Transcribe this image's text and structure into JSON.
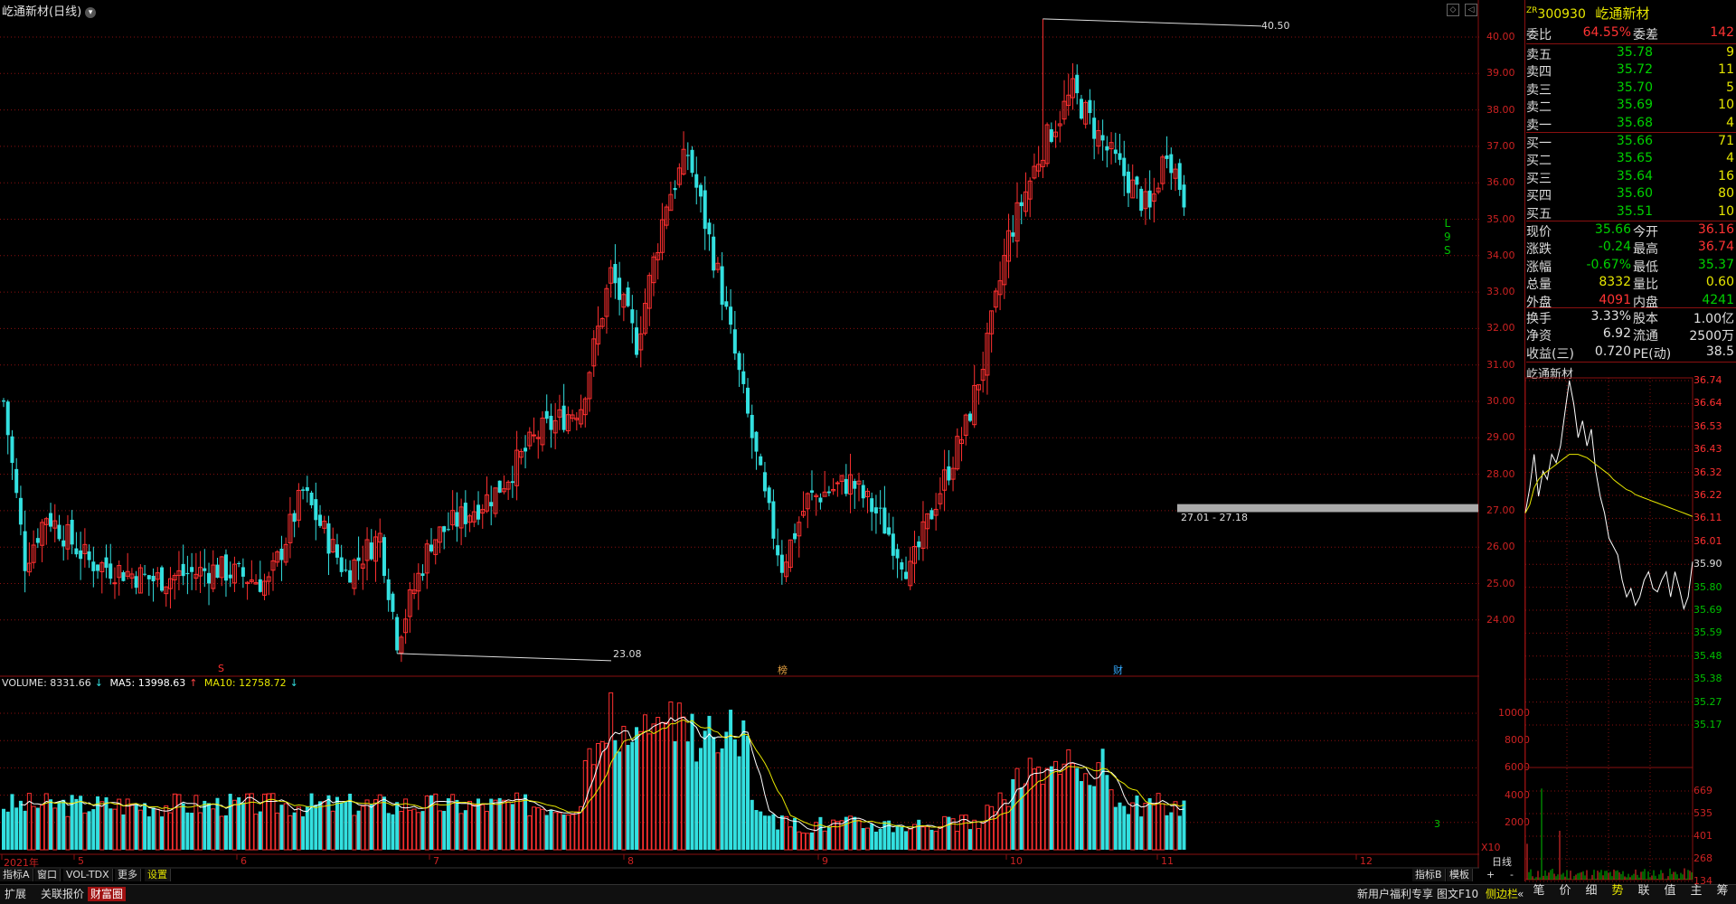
{
  "window": {
    "title": "屹通新材(日线)",
    "title_icon": "chevron-down-icon"
  },
  "price_axis": [
    {
      "label": "40.00",
      "v": 40
    },
    {
      "label": "39.00",
      "v": 39
    },
    {
      "label": "38.00",
      "v": 38
    },
    {
      "label": "37.00",
      "v": 37
    },
    {
      "label": "36.00",
      "v": 36
    },
    {
      "label": "35.00",
      "v": 35
    },
    {
      "label": "34.00",
      "v": 34
    },
    {
      "label": "33.00",
      "v": 33
    },
    {
      "label": "32.00",
      "v": 32
    },
    {
      "label": "31.00",
      "v": 31
    },
    {
      "label": "30.00",
      "v": 30
    },
    {
      "label": "29.00",
      "v": 29
    },
    {
      "label": "28.00",
      "v": 28
    },
    {
      "label": "27.00",
      "v": 27
    },
    {
      "label": "26.00",
      "v": 26
    },
    {
      "label": "25.00",
      "v": 25
    },
    {
      "label": "24.00",
      "v": 24
    }
  ],
  "annotations": {
    "high_label": "40.50",
    "low_label": "23.08",
    "range_label": "27.01 - 27.18",
    "markers": [
      "S",
      "榜",
      "财"
    ],
    "side_letters": [
      "L",
      "9",
      "S"
    ]
  },
  "volume_indicator": {
    "name": "VOLUME: 8331.66",
    "ma5": "MA5: 13998.63",
    "ma10": "MA10: 12758.72",
    "ticks": [
      "10000",
      "8000",
      "6000",
      "4000",
      "2000"
    ],
    "unit": "X10",
    "last_label": "3"
  },
  "x_axis": {
    "labels": [
      "2021年",
      "5",
      "6",
      "7",
      "8",
      "9",
      "10",
      "11",
      "12"
    ]
  },
  "tabs": [
    "指标A",
    "窗口",
    "VOL-TDX",
    "更多",
    "设置"
  ],
  "tabs_right": [
    "指标B",
    "模板",
    "+",
    "-",
    "日线"
  ],
  "bottom_bar": {
    "left": [
      "扩展",
      "关联报价",
      "财富圈"
    ],
    "right": [
      "新用户福利专享",
      "图文F10",
      "侧边栏",
      "«"
    ]
  },
  "quote_panel": {
    "code": "300930",
    "code_prefix": "ZR",
    "name": "屹通新材",
    "ratio_label": "委比",
    "ratio_value": "64.55%",
    "diff_label": "委差",
    "diff_value": "142",
    "asks": [
      {
        "label": "卖五",
        "price": "35.78",
        "vol": "9"
      },
      {
        "label": "卖四",
        "price": "35.72",
        "vol": "11"
      },
      {
        "label": "卖三",
        "price": "35.70",
        "vol": "5"
      },
      {
        "label": "卖二",
        "price": "35.69",
        "vol": "10"
      },
      {
        "label": "卖一",
        "price": "35.68",
        "vol": "4"
      }
    ],
    "bids": [
      {
        "label": "买一",
        "price": "35.66",
        "vol": "71"
      },
      {
        "label": "买二",
        "price": "35.65",
        "vol": "4"
      },
      {
        "label": "买三",
        "price": "35.64",
        "vol": "16"
      },
      {
        "label": "买四",
        "price": "35.60",
        "vol": "80"
      },
      {
        "label": "买五",
        "price": "35.51",
        "vol": "10"
      }
    ],
    "stats": [
      {
        "l1": "现价",
        "v1": "35.66",
        "c1": "green",
        "l2": "今开",
        "v2": "36.16",
        "c2": "red"
      },
      {
        "l1": "涨跌",
        "v1": "-0.24",
        "c1": "green",
        "l2": "最高",
        "v2": "36.74",
        "c2": "red"
      },
      {
        "l1": "涨幅",
        "v1": "-0.67%",
        "c1": "green",
        "l2": "最低",
        "v2": "35.37",
        "c2": "green"
      },
      {
        "l1": "总量",
        "v1": "8332",
        "c1": "yellow",
        "l2": "量比",
        "v2": "0.60",
        "c2": "yellow"
      },
      {
        "l1": "外盘",
        "v1": "4091",
        "c1": "red",
        "l2": "内盘",
        "v2": "4241",
        "c2": "green"
      }
    ],
    "stats2": [
      {
        "l1": "换手",
        "v1": "3.33%",
        "c1": "white",
        "l2": "股本",
        "v2": "1.00亿",
        "c2": "white"
      },
      {
        "l1": "净资",
        "v1": "6.92",
        "c1": "white",
        "l2": "流通",
        "v2": "2500万",
        "c2": "white"
      },
      {
        "l1": "收益(三)",
        "v1": "0.720",
        "c1": "white",
        "l2": "PE(动)",
        "v2": "38.5",
        "c2": "white"
      }
    ]
  },
  "minute_chart": {
    "title": "屹通新材",
    "price_ticks": [
      "36.74",
      "36.64",
      "36.53",
      "36.43",
      "36.32",
      "36.22",
      "36.11",
      "36.01",
      "35.90",
      "35.80",
      "35.69",
      "35.59",
      "35.48",
      "35.38",
      "35.27",
      "35.17"
    ],
    "vol_ticks": [
      "669",
      "535",
      "401",
      "268",
      "134"
    ],
    "bottom_tabs": [
      "笔",
      "价",
      "细",
      "势",
      "联",
      "值",
      "主",
      "筹"
    ],
    "selected_tab": "势"
  },
  "colors": {
    "up": "#ff3030",
    "down": "#33e0e0",
    "ma5": "#ffffff",
    "ma10": "#e6e600",
    "grid": "#8a1010"
  }
}
